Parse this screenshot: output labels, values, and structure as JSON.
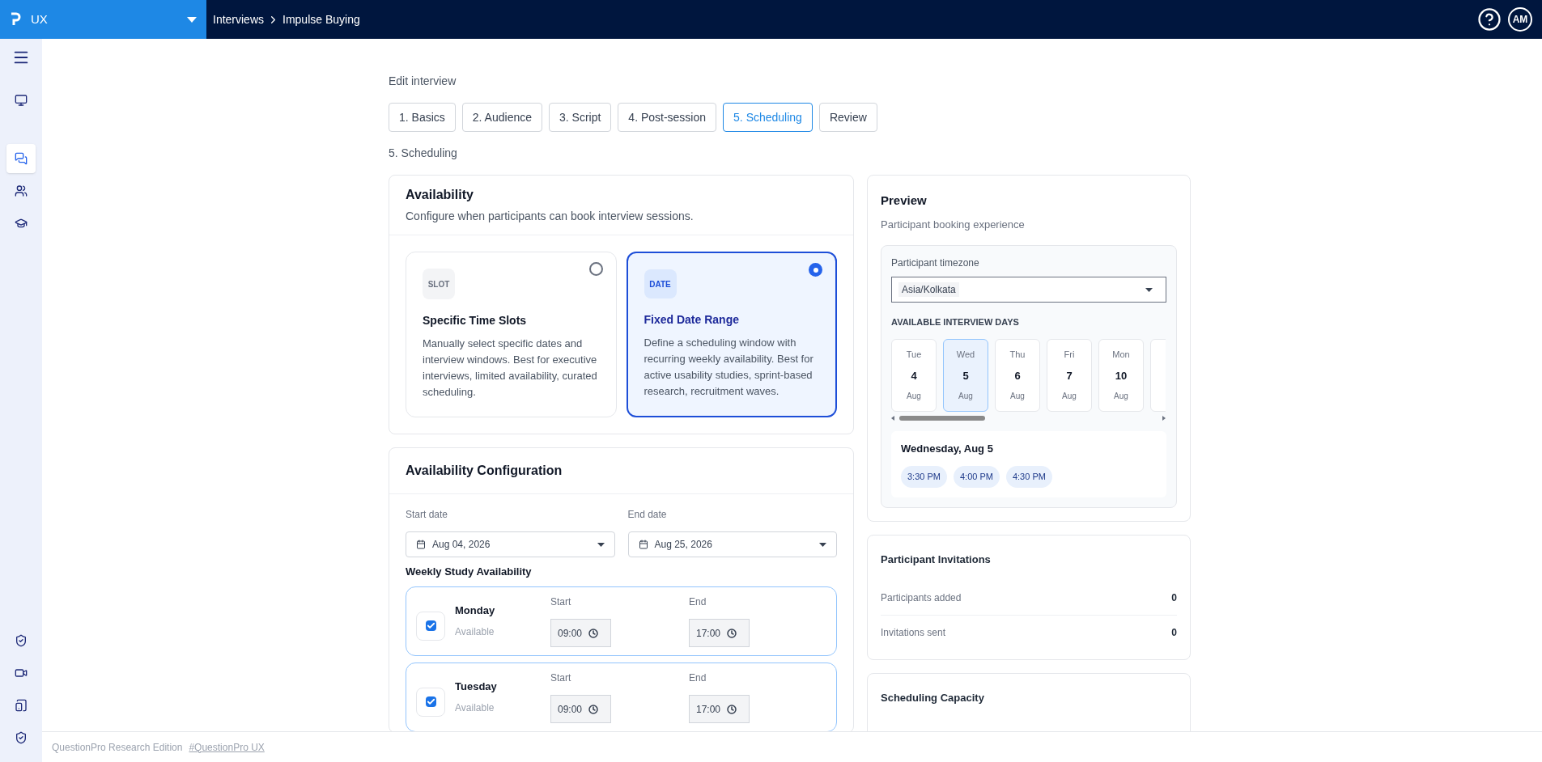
{
  "top_bar": {
    "workspace": "UX",
    "breadcrumb": [
      "Interviews",
      "Impulse Buying"
    ],
    "avatar": "AM"
  },
  "sidebar": {
    "items": [
      {
        "selected": false
      },
      {
        "selected": true
      },
      {
        "selected": false
      },
      {
        "selected": false
      }
    ]
  },
  "page": {
    "heading": "Edit interview",
    "section": "5. Scheduling"
  },
  "tabs": [
    {
      "label": "1. Basics",
      "selected": false
    },
    {
      "label": "2. Audience",
      "selected": false
    },
    {
      "label": "3. Script",
      "selected": false
    },
    {
      "label": "4. Post-session",
      "selected": false
    },
    {
      "label": "5. Scheduling",
      "selected": true
    },
    {
      "label": "Review",
      "selected": false
    }
  ],
  "availability": {
    "title": "Availability",
    "subtitle": "Configure when participants can book interview sessions.",
    "options": [
      {
        "tag": "SLOT",
        "title": "Specific Time Slots",
        "description": "Manually select specific dates and interview windows. Best for executive interviews, limited availability, curated scheduling.",
        "selected": false
      },
      {
        "tag": "DATE",
        "title": "Fixed Date Range",
        "description": "Define a scheduling window with recurring weekly availability. Best for active usability studies, sprint-based research, recruitment waves.",
        "selected": true
      }
    ]
  },
  "configuration": {
    "title": "Availability Configuration",
    "start_date": {
      "label": "Start date",
      "value": "Aug 04, 2026"
    },
    "end_date": {
      "label": "End date",
      "value": "Aug 25, 2026"
    },
    "weekly_title": "Weekly Study Availability",
    "days": [
      {
        "name": "Monday",
        "status": "Available",
        "checked": true,
        "start_label": "Start",
        "start": "09:00",
        "end_label": "End",
        "end": "17:00"
      },
      {
        "name": "Tuesday",
        "status": "Available",
        "checked": true,
        "start_label": "Start",
        "start": "09:00",
        "end_label": "End",
        "end": "17:00"
      }
    ]
  },
  "preview": {
    "title": "Preview",
    "subtitle": "Participant booking experience",
    "timezone_label": "Participant timezone",
    "timezone": "Asia/Kolkata",
    "days_title": "AVAILABLE INTERVIEW DAYS",
    "days": [
      {
        "weekday": "Tue",
        "day": "4",
        "month": "Aug",
        "selected": false
      },
      {
        "weekday": "Wed",
        "day": "5",
        "month": "Aug",
        "selected": true
      },
      {
        "weekday": "Thu",
        "day": "6",
        "month": "Aug",
        "selected": false
      },
      {
        "weekday": "Fri",
        "day": "7",
        "month": "Aug",
        "selected": false
      },
      {
        "weekday": "Mon",
        "day": "10",
        "month": "Aug",
        "selected": false
      }
    ],
    "selected_date": "Wednesday, Aug 5",
    "times": [
      "3:30 PM",
      "4:00 PM",
      "4:30 PM"
    ]
  },
  "invitations": {
    "title": "Participant Invitations",
    "rows": [
      {
        "label": "Participants added",
        "value": "0"
      },
      {
        "label": "Invitations sent",
        "value": "0"
      }
    ]
  },
  "capacity": {
    "title": "Scheduling Capacity"
  },
  "footer": {
    "text": "QuestionPro Research Edition",
    "link": "#QuestionPro UX"
  }
}
